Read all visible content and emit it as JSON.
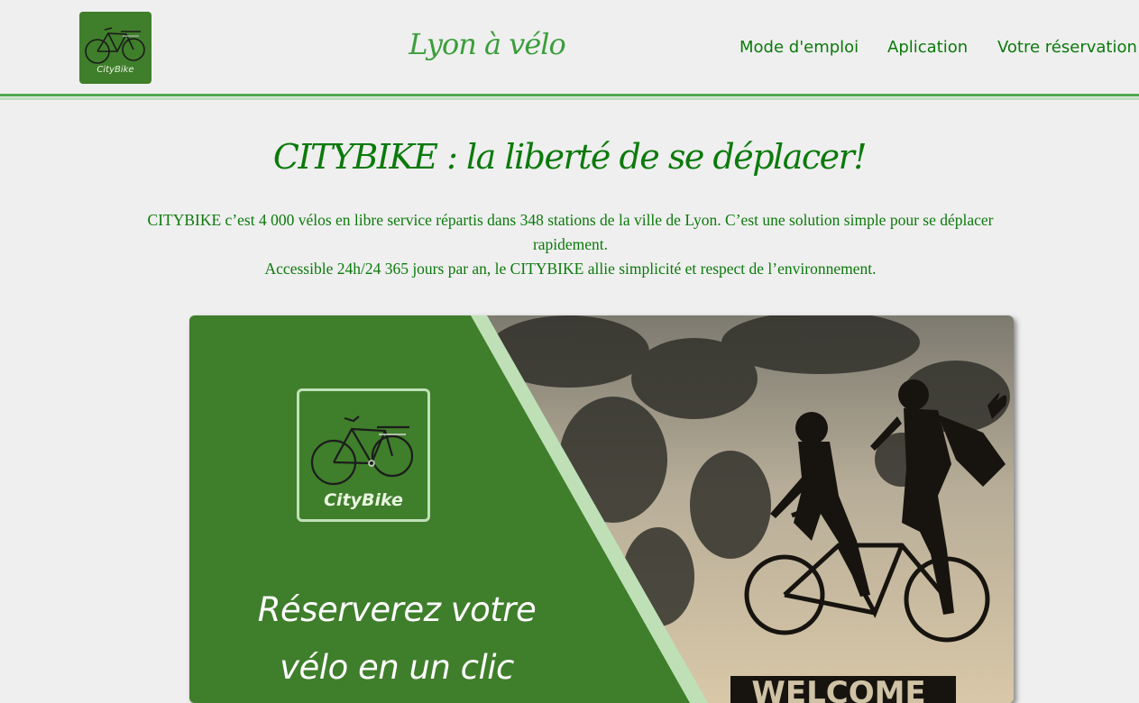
{
  "header": {
    "logo_text": "CityBike",
    "site_title": "Lyon à vélo",
    "nav": [
      {
        "label": "Mode d'emploi"
      },
      {
        "label": "Aplication"
      },
      {
        "label": "Votre réservation"
      }
    ]
  },
  "hero": {
    "title": "CITYBIKE : la liberté de se déplacer!",
    "paragraph_1": "CITYBIKE c’est 4 000 vélos en libre service répartis dans 348 stations de la ville de Lyon. C’est une solution simple pour se déplacer rapidement.",
    "paragraph_2": "Accessible 24h/24 365 jours par an, le CITYBIKE allie simplicité et respect de l’environnement."
  },
  "banner": {
    "logo_text": "CityBike",
    "promo_line_1": "Réserverez votre",
    "promo_line_2": "vélo en un clic",
    "sign_text": "WELCOME"
  },
  "colors": {
    "brand_green": "#0b7a0b",
    "banner_green": "#3f7e2b",
    "accent_light_green": "#bfe0b6"
  },
  "icons": [
    "bicycle-icon",
    "bicycle-icon",
    "children-on-bicycle-silhouette"
  ]
}
